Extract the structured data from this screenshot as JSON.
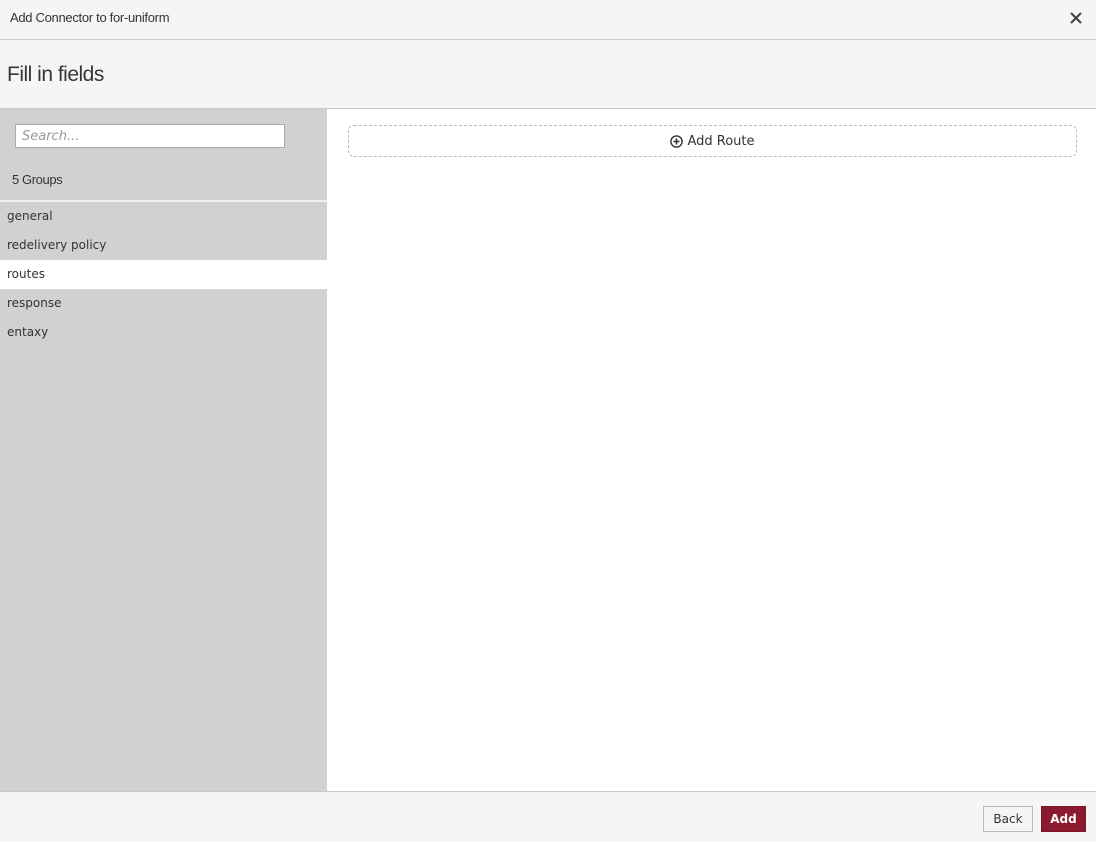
{
  "window": {
    "title": "Add Connector to for-uniform",
    "close_icon": "close-icon"
  },
  "header": {
    "title": "Fill in fields"
  },
  "sidebar": {
    "search": {
      "placeholder": "Search...",
      "value": ""
    },
    "groups_count": "5 Groups",
    "items": [
      {
        "label": "general",
        "active": false
      },
      {
        "label": "redelivery policy",
        "active": false
      },
      {
        "label": "routes",
        "active": true
      },
      {
        "label": "response",
        "active": false
      },
      {
        "label": "entaxy",
        "active": false
      }
    ]
  },
  "main": {
    "add_route_label": "Add Route",
    "add_route_icon": "plus-circle-icon"
  },
  "footer": {
    "back_label": "Back",
    "add_label": "Add"
  },
  "colors": {
    "accent": "#8b1a2f",
    "sidebar_bg": "#d1d1d1",
    "header_bg": "#f5f5f5"
  }
}
